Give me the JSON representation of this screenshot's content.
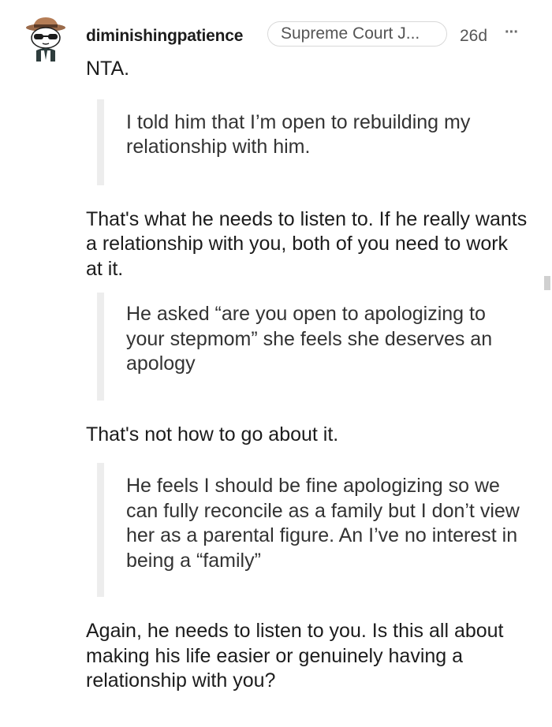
{
  "comment": {
    "username": "diminishingpatience",
    "flair": "Supreme Court J...",
    "age": "26d",
    "more_icon": "···",
    "paragraphs": [
      "NTA.",
      "I told him that I’m open to rebuilding my relationship with him.",
      "That's what he needs to listen to. If he really wants a relationship with you, both of you need to work at it.",
      "He asked “are you open to apologizing to your stepmom” she feels she deserves an apology",
      "That's not how to go about it.",
      "He feels I should be fine apologizing so we can fully reconcile as a family but I don’t view her as a parental figure. An I’ve no interest in being a “family”",
      "Again, he needs to listen to you. Is this all about making his life easier or genuinely having a relationship with you?"
    ]
  },
  "colors": {
    "text": "#1c1c1c",
    "muted": "#555555",
    "quote_bar": "#ededed",
    "flair_border": "#d9d9d9"
  }
}
